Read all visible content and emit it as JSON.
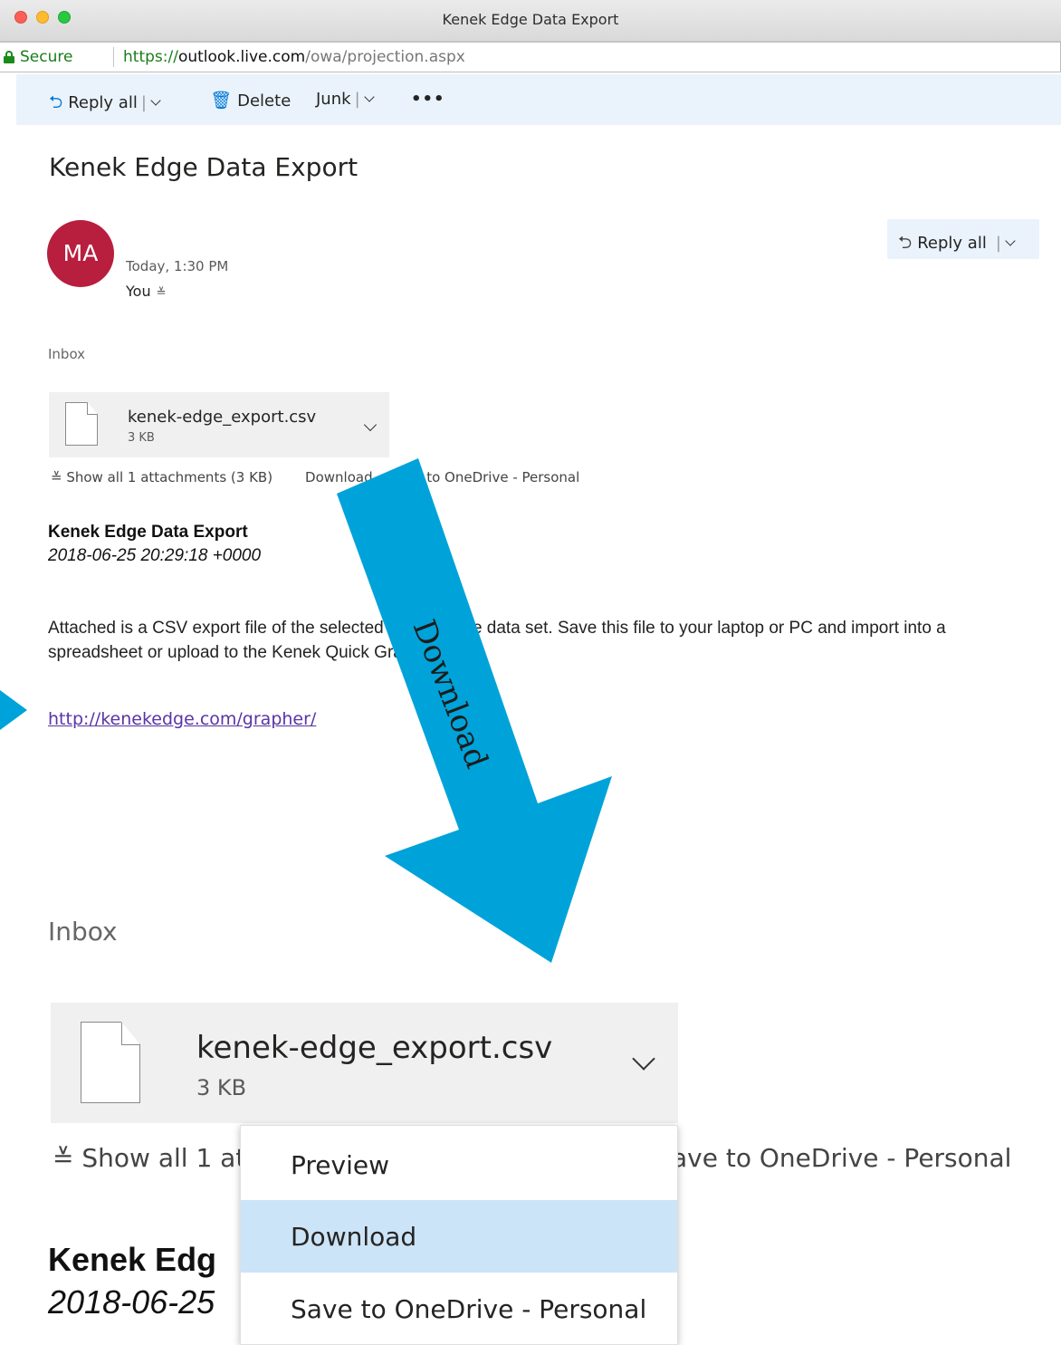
{
  "window": {
    "title": "Kenek Edge Data Export"
  },
  "address_bar": {
    "secure_label": "Secure",
    "url_scheme": "https://",
    "url_host": "outlook.live.com",
    "url_path": "/owa/projection.aspx"
  },
  "toolbar": {
    "reply_all": "Reply all",
    "delete": "Delete",
    "junk": "Junk",
    "more": "•••"
  },
  "message": {
    "subject": "Kenek Edge Data Export",
    "avatar_initials": "MA",
    "timestamp": "Today, 1:30 PM",
    "to": "You",
    "reply_all_button": "Reply all",
    "folder": "Inbox",
    "attachment": {
      "name": "kenek-edge_export.csv",
      "size": "3 KB"
    },
    "attachment_links": {
      "show_all": "Show all 1 attachments (3 KB)",
      "download": "Download",
      "save_onedrive_full": "Save to OneDrive - Personal"
    },
    "body": {
      "title": "Kenek Edge Data Export",
      "date": "2018-06-25 20:29:18 +0000",
      "text": "Attached is a CSV export file of the selected Kenek Edge data set. Save this file to your laptop or PC and import into a spreadsheet or upload to the Kenek Quick Grapher tool:",
      "link": "http://kenekedge.com/grapher/"
    }
  },
  "zoom_inset": {
    "folder": "Inbox",
    "attachment_name": "kenek-edge_export.csv",
    "attachment_size": "3 KB",
    "show_all_partial": "Show all 1 at",
    "save_onedrive_partial": "ave to OneDrive - Personal",
    "body_title_partial": "Kenek Edg",
    "body_date_partial": "2018-06-25",
    "menu": [
      {
        "label": "Preview",
        "highlighted": false
      },
      {
        "label": "Download",
        "highlighted": true
      },
      {
        "label": "Save to OneDrive - Personal",
        "highlighted": false
      }
    ]
  },
  "annotation": {
    "arrow_label": "Download",
    "arrow_color": "#00a3d9"
  },
  "colors": {
    "accent": "#0078d4",
    "toolbar_bg": "#eaf3fc",
    "avatar_bg": "#b81e3e",
    "link": "#5a34a6",
    "menu_highlight": "#cce4f7",
    "secure_green": "#1a7d1a"
  }
}
